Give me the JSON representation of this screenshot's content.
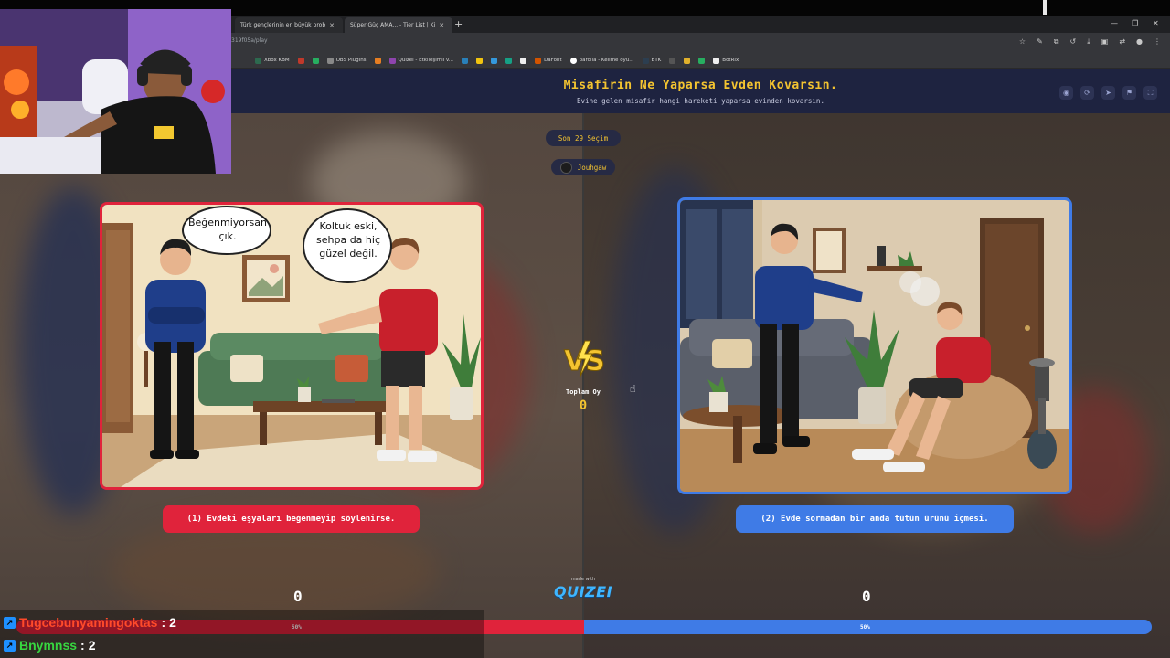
{
  "browser": {
    "tabs": [
      {
        "label": "Türk gençlerinin en büyük prob"
      },
      {
        "label": "Süper Güç AMA... - Tier List | Ki"
      }
    ],
    "url": "319f05a/play",
    "bookmarks": [
      "Xbox KBM",
      "OBS Plugins",
      "Quizei - Etkileşimli v...",
      "DaFont",
      "parolla - Kelime oyu...",
      "BTK",
      "BotRix"
    ]
  },
  "header": {
    "title": "Misafirin Ne Yaparsa Evden Kovarsın.",
    "subtitle": "Evine gelen misafir hangi hareketi yaparsa evinden kovarsın."
  },
  "round": {
    "label": "Son 29 Seçim",
    "user": "Jouhgaw"
  },
  "left_card": {
    "bubble1": "Beğenmiyorsan çık.",
    "bubble2": "Koltuk eski, sehpa da hiç güzel değil."
  },
  "options": {
    "left": "(1) Evdeki eşyaları beğenmeyip söylenirse.",
    "right": "(2) Evde sormadan bir anda tütün ürünü içmesi."
  },
  "vs": {
    "total_label": "Toplam Oy",
    "total_value": "0"
  },
  "scores": {
    "left": "0",
    "right": "0"
  },
  "brand": {
    "made_with": "made with",
    "name": "QUIZEI"
  },
  "votes": {
    "left_pct": "50%",
    "right_pct": "50%",
    "left_fraction": 0.5
  },
  "chat": [
    {
      "user": "Tugcebunyamingoktas",
      "count": "2"
    },
    {
      "user": "Bnymnss",
      "count": "2"
    }
  ],
  "colors": {
    "red": "#e0233b",
    "blue": "#3f7be6",
    "gold": "#f4c430",
    "header_bg": "#1e2340"
  },
  "header_icons": [
    "eye-icon",
    "shuffle-icon",
    "send-icon",
    "flag-icon",
    "fullscreen-icon"
  ]
}
